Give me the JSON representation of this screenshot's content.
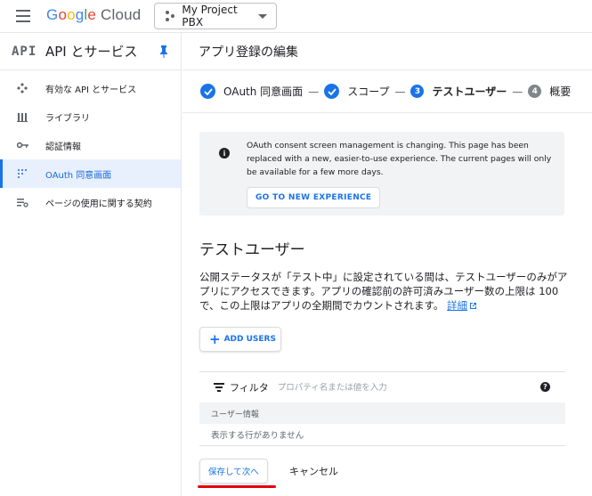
{
  "topbar": {
    "brand": [
      "G",
      "o",
      "o",
      "g",
      "l",
      "e"
    ],
    "product": "Cloud",
    "project_name": "My Project PBX"
  },
  "sidebar": {
    "header_logo": "API",
    "title": "API とサービス",
    "items": [
      {
        "label": "有効な API とサービス",
        "icon": "api-icon",
        "active": false
      },
      {
        "label": "ライブラリ",
        "icon": "library-icon",
        "active": false
      },
      {
        "label": "認証情報",
        "icon": "key-icon",
        "active": false
      },
      {
        "label": "OAuth 同意画面",
        "icon": "oauth-icon",
        "active": true
      },
      {
        "label": "ページの使用に関する契約",
        "icon": "settings-list-icon",
        "active": false
      }
    ]
  },
  "main": {
    "page_title": "アプリ登録の編集",
    "steps": [
      {
        "label": "OAuth 同意画面",
        "state": "done"
      },
      {
        "label": "スコープ",
        "state": "done"
      },
      {
        "number": "3",
        "label": "テストユーザー",
        "state": "current"
      },
      {
        "number": "4",
        "label": "概要",
        "state": "pending"
      }
    ],
    "step_separator": "—",
    "notice": {
      "text": "OAuth consent screen management is changing. This page has been replaced with a new, easier-to-use experience. The current pages will only be available for a few more days.",
      "button": "GO TO NEW EXPERIENCE"
    },
    "section_title": "テストユーザー",
    "description": "公開ステータスが「テスト中」に設定されている間は、テストユーザーのみがアプリにアクセスできます。アプリの確認前の許可済みユーザー数の上限は 100 で、この上限はアプリの全期間でカウントされます。",
    "learn_more": "詳細",
    "add_users_label": "ADD USERS",
    "table": {
      "filter_label": "フィルタ",
      "filter_placeholder": "プロパティ名または値を入力",
      "column_header": "ユーザー情報",
      "empty_text": "表示する行がありません"
    },
    "save_label": "保存して次へ",
    "cancel_label": "キャンセル"
  },
  "colors": {
    "accent": "#1a73e8",
    "highlight_underline": "#e3000b",
    "active_bg": "#e8f0fe"
  }
}
